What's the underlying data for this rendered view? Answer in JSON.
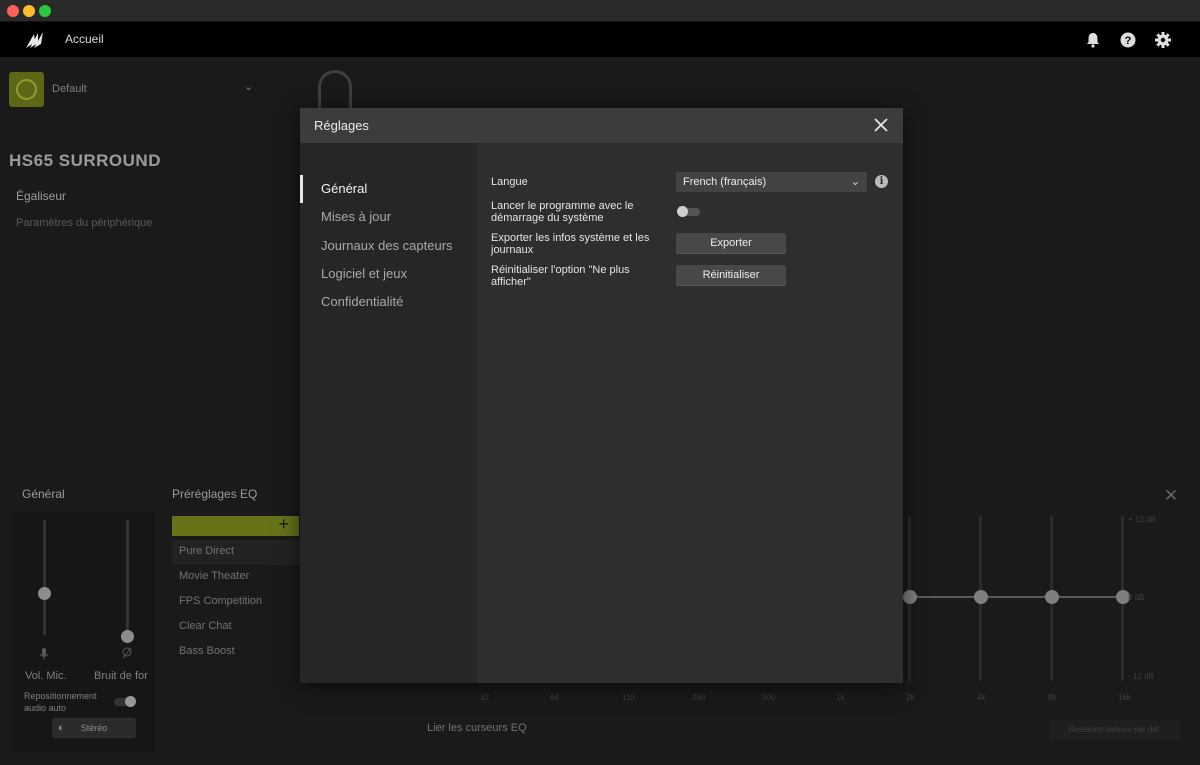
{
  "app": {
    "home_label": "Accueil"
  },
  "profile": {
    "name": "Default"
  },
  "device": {
    "title": "HS65 SURROUND",
    "nav": [
      "Égaliseur",
      "Paramètres du périphérique"
    ]
  },
  "general_section": {
    "title": "Général",
    "vol_mic_label": "Vol. Mic.",
    "noise_label": "Bruit de for",
    "reposition_label": "Repositionnement audio auto",
    "stereo_label": "Stéréo"
  },
  "presets": {
    "title": "Préréglages EQ",
    "items": [
      "Pure Direct",
      "Movie Theater",
      "FPS Competition",
      "Clear Chat",
      "Bass Boost"
    ],
    "active": "Pure Direct"
  },
  "eq": {
    "axis_top": "+ 12 dB",
    "axis_mid": "0 dB",
    "axis_bottom": "- 12 dB",
    "freqs": [
      "32",
      "64",
      "125",
      "250",
      "500",
      "1k",
      "2k",
      "4k",
      "8k",
      "16k"
    ],
    "link_label": "Lier les curseurs EQ",
    "reset_label": "Restaurer valeurs par déf."
  },
  "settings_modal": {
    "title": "Réglages",
    "sidebar": [
      "Général",
      "Mises à jour",
      "Journaux des capteurs",
      "Logiciel et jeux",
      "Confidentialité"
    ],
    "active_tab": "Général",
    "language_label": "Langue",
    "language_value": "French (français)",
    "startup_label": "Lancer le programme avec le démarrage du système",
    "startup_enabled": false,
    "export_label": "Exporter les infos système et les journaux",
    "export_button": "Exporter",
    "reset_label": "Réinitialiser l'option \"Ne plus afficher\"",
    "reset_button": "Réinitialiser"
  },
  "colors": {
    "accent": "#8b9a22",
    "modal_bg": "#2d2c2e"
  },
  "icons": [
    "corsair-logo-icon",
    "bell-icon",
    "help-icon",
    "gear-icon",
    "close-icon",
    "chevron-down-icon",
    "info-icon",
    "headset-icon",
    "mic-icon",
    "plus-icon"
  ]
}
